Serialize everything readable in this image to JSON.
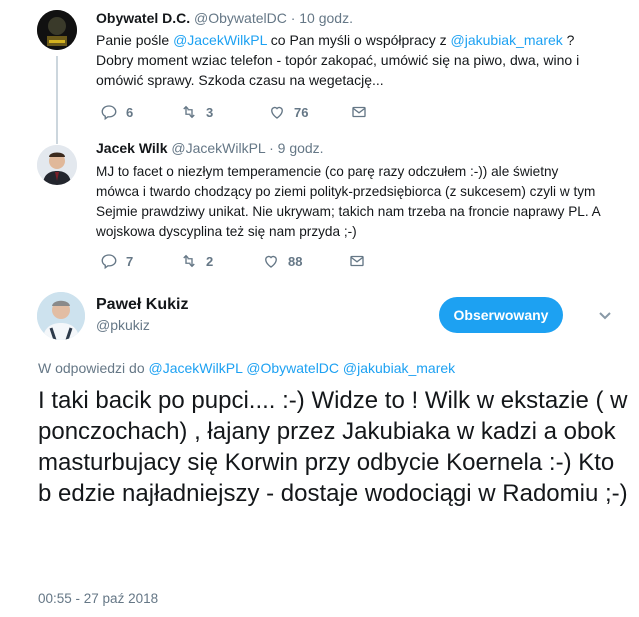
{
  "tweets": [
    {
      "name": "Obywatel D.C.",
      "handle": "@ObywatelDC",
      "time": "· 10 godz.",
      "text_parts": {
        "a": "Panie pośle ",
        "m1": "@JacekWilkPL",
        "b": " co Pan myśli o współpracy z ",
        "m2": "@jakubiak_marek",
        "c": " ? Dobry moment wziac telefon - topór zakopać, umówić się na piwo, dwa, wino i omówić sprawy. Szkoda czasu na wegetację..."
      },
      "replies": "6",
      "retweets": "3",
      "likes": "76"
    },
    {
      "name": "Jacek Wilk",
      "handle": "@JacekWilkPL",
      "time": "· 9 godz.",
      "text": "MJ to facet o niezłym temperamencie (co parę razy odczułem :-)) ale świetny mówca i twardo chodzący po ziemi polityk-przedsiębiorca (z sukcesem) czyli w tym Sejmie prawdziwy unikat. Nie ukrywam; takich nam trzeba na froncie naprawy PL. A wojskowa dyscyplina też się nam przyda ;-)",
      "replies": "7",
      "retweets": "2",
      "likes": "88"
    }
  ],
  "main": {
    "name": "Paweł Kukiz",
    "handle": "@pkukiz",
    "follow_label": "Obserwowany",
    "reply_prefix": "W odpowiedzi do ",
    "reply_mentions": "@JacekWilkPL @ObywatelDC @jakubiak_marek",
    "text": "I taki bacik po pupci.... :-) Widze to ! Wilk w ekstazie  ( w ponczochach) , łajany przez Jakubiaka w kadzi a obok masturbujacy się Korwin przy odbycie Koernela :-) Kto b edzie najładniejszy - dostaje wodociągi w Radomiu ;-)",
    "timestamp": "00:55 - 27 paź 2018"
  },
  "colors": {
    "accent": "#1da1f2",
    "muted": "#657786",
    "line": "#ccd6dd"
  },
  "icons": [
    "reply-icon",
    "retweet-icon",
    "like-icon",
    "message-icon",
    "chevron-down-icon"
  ]
}
